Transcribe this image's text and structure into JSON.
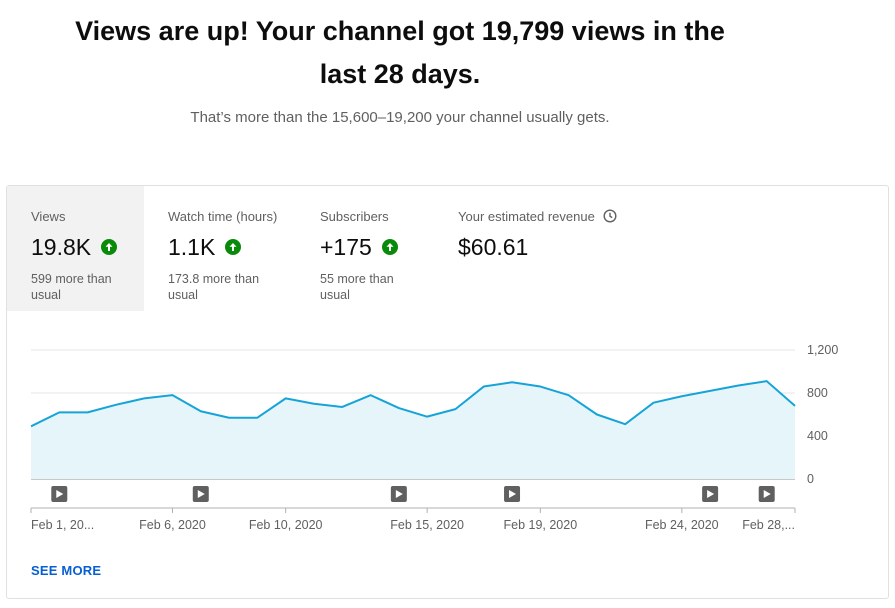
{
  "headline": "Views are up! Your channel got 19,799 views in the last 28 days.",
  "subline": "That’s more than the 15,600–19,200 your channel usually gets.",
  "metrics": [
    {
      "label": "Views",
      "value": "19.8K",
      "note": "599 more than usual",
      "trend_icon": "arrow-up-circle-icon",
      "selected": true
    },
    {
      "label": "Watch time (hours)",
      "value": "1.1K",
      "note": "173.8 more than usual",
      "trend_icon": "arrow-up-circle-icon",
      "selected": false
    },
    {
      "label": "Subscribers",
      "value": "+175",
      "note": "55 more than usual",
      "trend_icon": "arrow-up-circle-icon",
      "selected": false
    },
    {
      "label": "Your estimated revenue",
      "value": "$60.61",
      "info_icon": "clock-icon",
      "selected": false
    }
  ],
  "see_more": "SEE MORE",
  "colors": {
    "line": "#16a4d8",
    "area": "#e6f5fa",
    "up": "#0a8a0a",
    "link": "#065fd4"
  },
  "chart_data": {
    "type": "area",
    "x": [
      "Feb 1",
      "Feb 2",
      "Feb 3",
      "Feb 4",
      "Feb 5",
      "Feb 6",
      "Feb 7",
      "Feb 8",
      "Feb 9",
      "Feb 10",
      "Feb 11",
      "Feb 12",
      "Feb 13",
      "Feb 14",
      "Feb 15",
      "Feb 16",
      "Feb 17",
      "Feb 18",
      "Feb 19",
      "Feb 20",
      "Feb 21",
      "Feb 22",
      "Feb 23",
      "Feb 24",
      "Feb 25",
      "Feb 26",
      "Feb 27",
      "Feb 28"
    ],
    "values": [
      490,
      620,
      620,
      690,
      750,
      780,
      630,
      570,
      570,
      750,
      700,
      670,
      780,
      660,
      580,
      650,
      860,
      900,
      860,
      780,
      600,
      510,
      710,
      770,
      820,
      870,
      910,
      680
    ],
    "y_ticks": [
      "1,200",
      "800",
      "400",
      "0"
    ],
    "y_tick_values": [
      1200,
      800,
      400,
      0
    ],
    "ylim": [
      0,
      1200
    ],
    "x_tick_labels": [
      "Feb 1, 20...",
      "Feb 6, 2020",
      "Feb 10, 2020",
      "Feb 15, 2020",
      "Feb 19, 2020",
      "Feb 24, 2020",
      "Feb 28,..."
    ],
    "x_tick_index": [
      0,
      5,
      9,
      14,
      18,
      23,
      27
    ],
    "video_markers_index": [
      1,
      6,
      13,
      17,
      24,
      26
    ],
    "grid": true
  }
}
